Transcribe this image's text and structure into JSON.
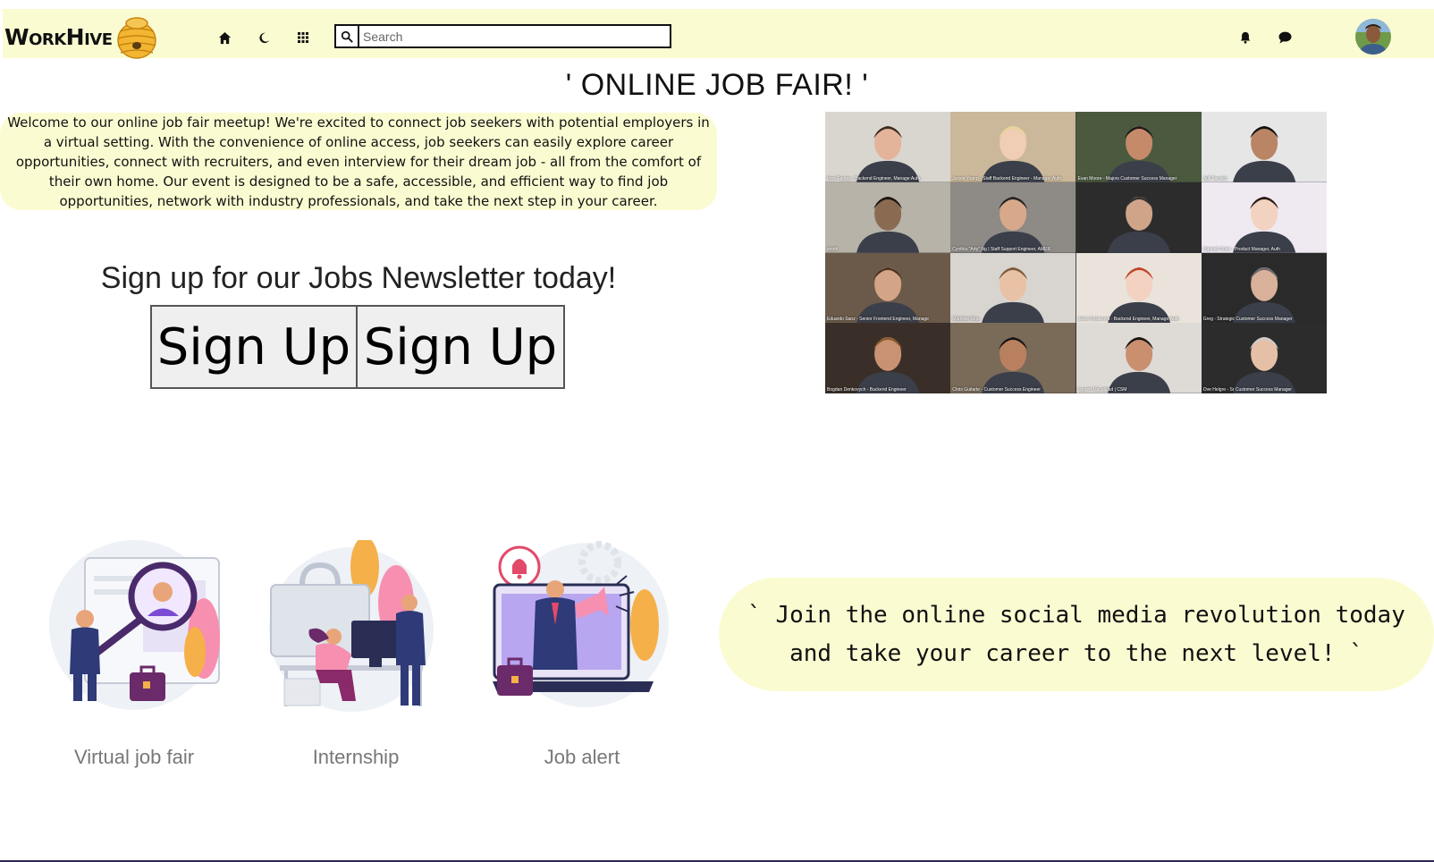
{
  "brand": {
    "logo_text": "WorkHive"
  },
  "navbar": {
    "search": {
      "placeholder": "Search",
      "value": ""
    },
    "icons": [
      "home-icon",
      "moon-icon",
      "grid-icon",
      "bell-icon",
      "chat-icon"
    ]
  },
  "page": {
    "title": "' ONLINE JOB FAIR! '",
    "welcome_text": "Welcome to our online job fair meetup! We're excited to connect job seekers with potential employers in a virtual setting. With the convenience of online access, job seekers can easily explore career opportunities, connect with recruiters, and even interview for their dream job - all from the comfort of their own home. Our event is designed to be a safe, accessible, and efficient way to find job opportunities, network with industry professionals, and take the next step in your career.",
    "newsletter_heading": "Sign up for our Jobs Newsletter today!",
    "signup_buttons": [
      "Sign Up",
      "Sign Up"
    ]
  },
  "video_call": {
    "participants": [
      "Imre Farkas - Backend Engineer, Manage:Auth",
      "Jessie Young - Staff Backend Engineer - Manage::Auth",
      "Evan Moore - Majors Customer Success Manager",
      "Adil Farrukh",
      "smriti",
      "Cynthia \"Arty\" Ng | Staff Support Engineer, AMER",
      "",
      "Hannah Sutor - Product Manager, Auth",
      "Eduardo Sanz - Senior Frontend Engineer, Manage",
      "Mathilde Riou",
      "Jarka Košanová - Backend Engineer, Manage:Auth",
      "Greg - Strategic Customer Success Manager",
      "Bogdan Denkovych - Backend Engineer",
      "Chris Guitarte - Customer Success Engineer",
      "Lauren Macalalad | CSM",
      "Ove Helgre - Sr Customer Success Manager"
    ]
  },
  "features": [
    {
      "label": "Virtual job fair",
      "icon": "virtual-job-fair-illustration"
    },
    {
      "label": "Internship",
      "icon": "internship-illustration"
    },
    {
      "label": "Job alert",
      "icon": "job-alert-illustration"
    }
  ],
  "promo": {
    "text": "` Join the online social media revolution today and take your career to the next level! `"
  },
  "colors": {
    "accent_bg": "#fbfbd2",
    "logo_hive": "#f2b632",
    "bottom_bar": "#2a2550"
  }
}
